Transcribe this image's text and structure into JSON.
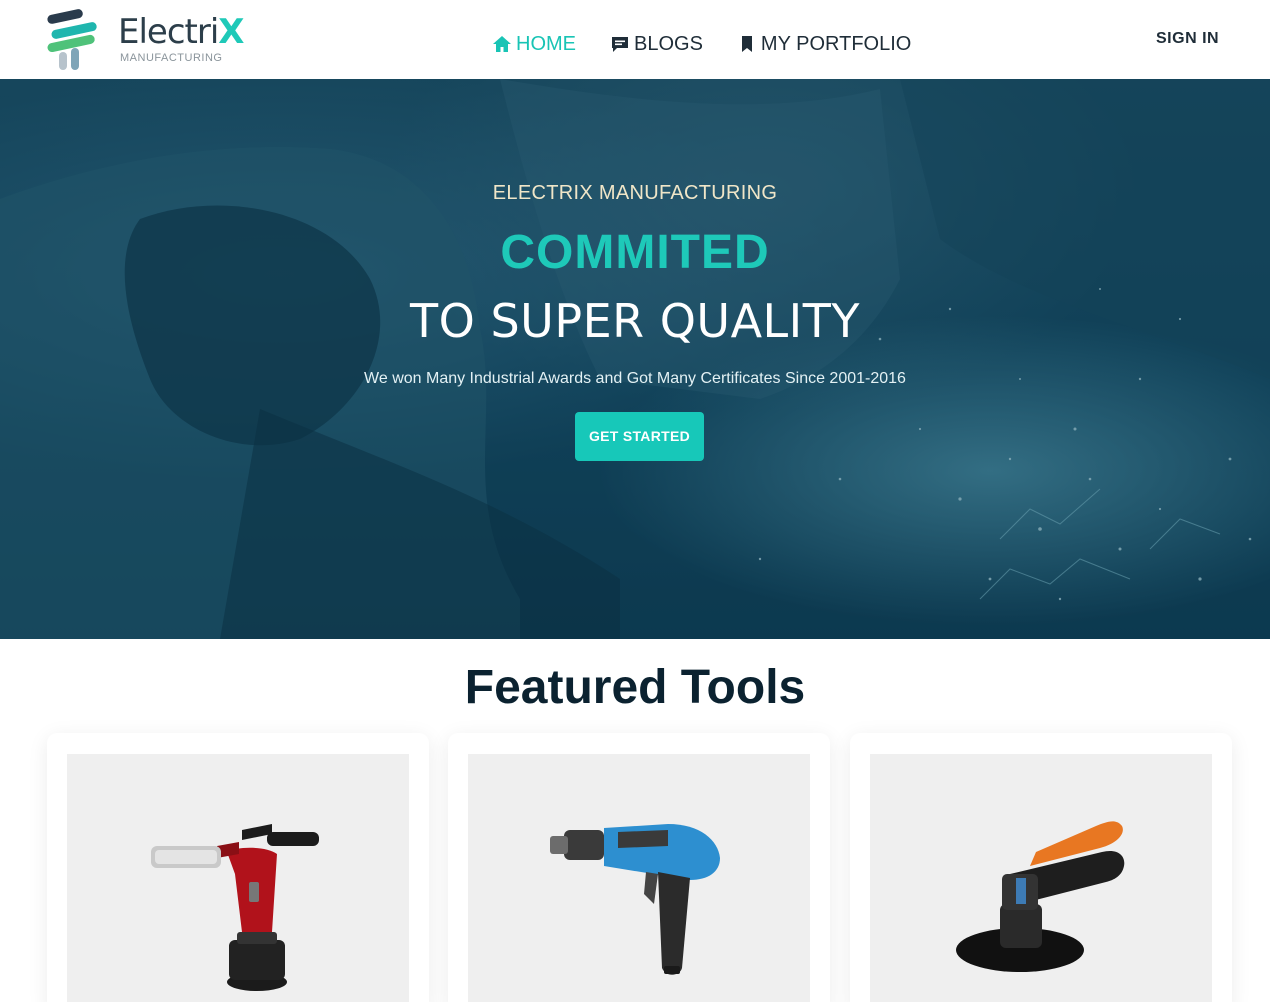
{
  "header": {
    "logo_name": "Electri",
    "logo_name_accent": "X",
    "logo_sub": "MANUFACTURING",
    "nav": [
      {
        "label": "HOME",
        "icon": "home-icon",
        "active": true
      },
      {
        "label": "BLOGS",
        "icon": "chat-icon",
        "active": false
      },
      {
        "label": "MY PORTFOLIO",
        "icon": "bookmark-icon",
        "active": false
      }
    ],
    "signin_label": "SIGN IN"
  },
  "hero": {
    "eyebrow": "ELECTRIX MANUFACTURING",
    "title": "COMMITED",
    "subtitle": "TO SUPER QUALITY",
    "description": "We won Many Industrial Awards and Got Many Certificates Since 2001-2016",
    "cta_label": "GET STARTED"
  },
  "featured": {
    "title": "Featured Tools",
    "cards": [
      {
        "image": "rivet-tool-image"
      },
      {
        "image": "air-drill-image"
      },
      {
        "image": "angle-sander-image"
      }
    ]
  },
  "colors": {
    "accent": "#19c4b5",
    "dark_text": "#0b2230",
    "hero_bg": "#14465f"
  }
}
